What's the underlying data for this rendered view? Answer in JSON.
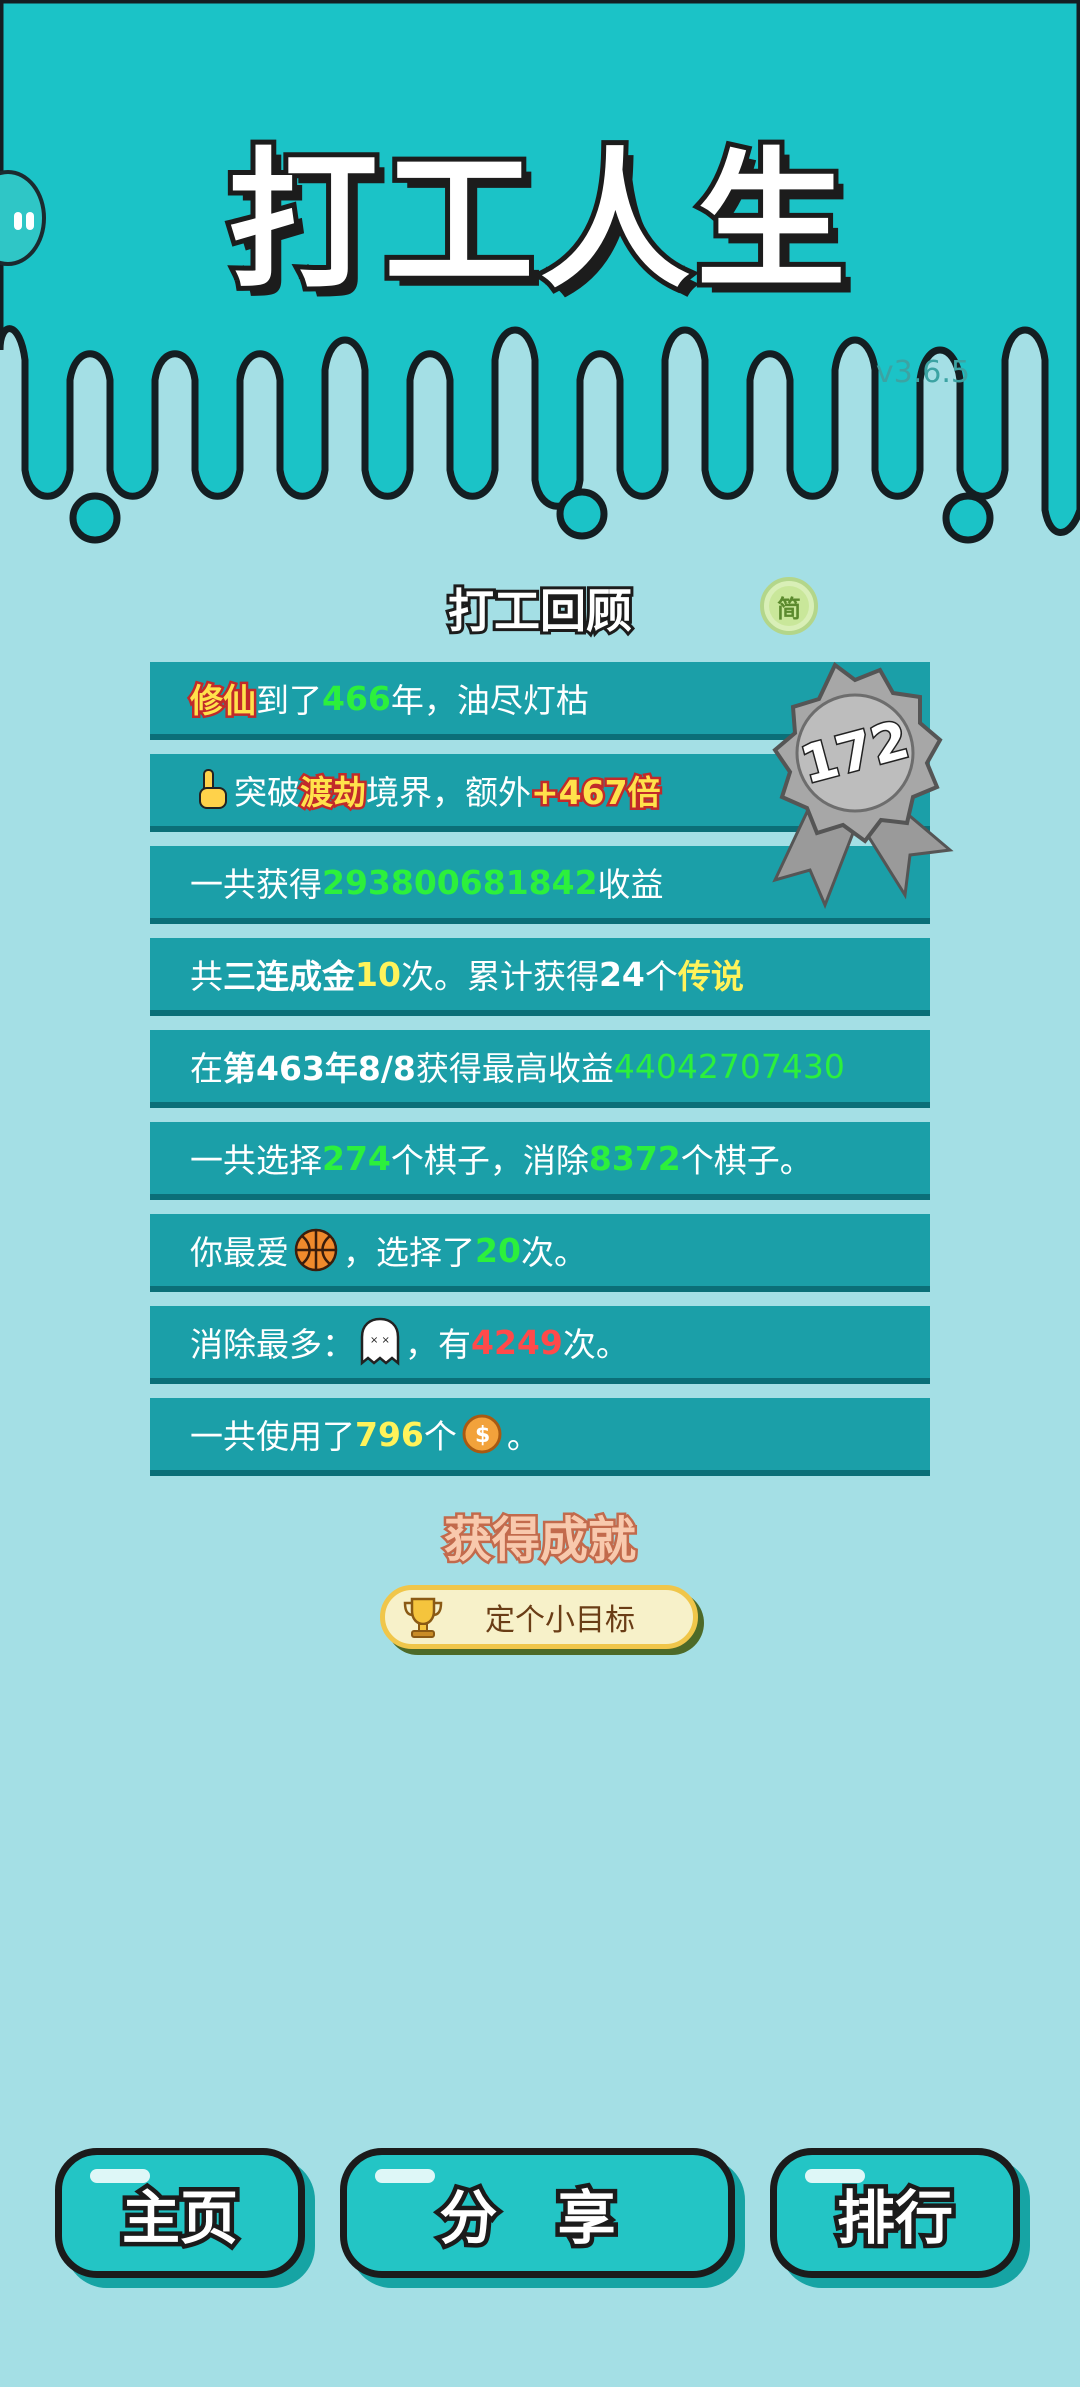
{
  "app": {
    "title": "打工人生",
    "version": "v3.6.5"
  },
  "review": {
    "title": "打工回顾",
    "simp_toggle": "简",
    "medal_number": "172",
    "rows": [
      {
        "parts": [
          "修仙",
          "到了",
          "466",
          "年，油尽灯枯"
        ]
      },
      {
        "parts": [
          "突破",
          "渡劫",
          "境界，额外",
          "+467倍"
        ]
      },
      {
        "parts": [
          "一共获得",
          "293800681842",
          "收益"
        ]
      },
      {
        "parts": [
          "共",
          "三连成金",
          "10",
          "次。累计获得",
          "24",
          "个",
          "传说"
        ]
      },
      {
        "parts": [
          "在 ",
          "第463年8/8",
          " 获得最高收益",
          "44042707430"
        ]
      },
      {
        "parts": [
          "一共选择",
          "274",
          "个棋子，消除",
          "8372",
          "个棋子。"
        ]
      },
      {
        "parts": [
          "你最爱",
          "，选择了",
          "20",
          "次。"
        ]
      },
      {
        "parts": [
          "消除最多：",
          "，有",
          "4249",
          "次。"
        ]
      },
      {
        "parts": [
          "一共使用了",
          "796",
          "个",
          "。"
        ]
      }
    ]
  },
  "achievement": {
    "title": "获得成就",
    "badge_label": "定个小目标"
  },
  "nav": {
    "home": "主页",
    "share": "分 享",
    "rank": "排行"
  },
  "colors": {
    "accent": "#23c5c5",
    "row_bg": "#1b9fa8",
    "green": "#2cf03c",
    "yellow": "#fff35a",
    "red": "#ff4a4a"
  },
  "icons": {
    "row2": "pointing-hand-icon",
    "row7": "basketball-icon",
    "row8": "ghost-icon",
    "row9": "coin-icon",
    "achievement": "trophy-icon"
  }
}
